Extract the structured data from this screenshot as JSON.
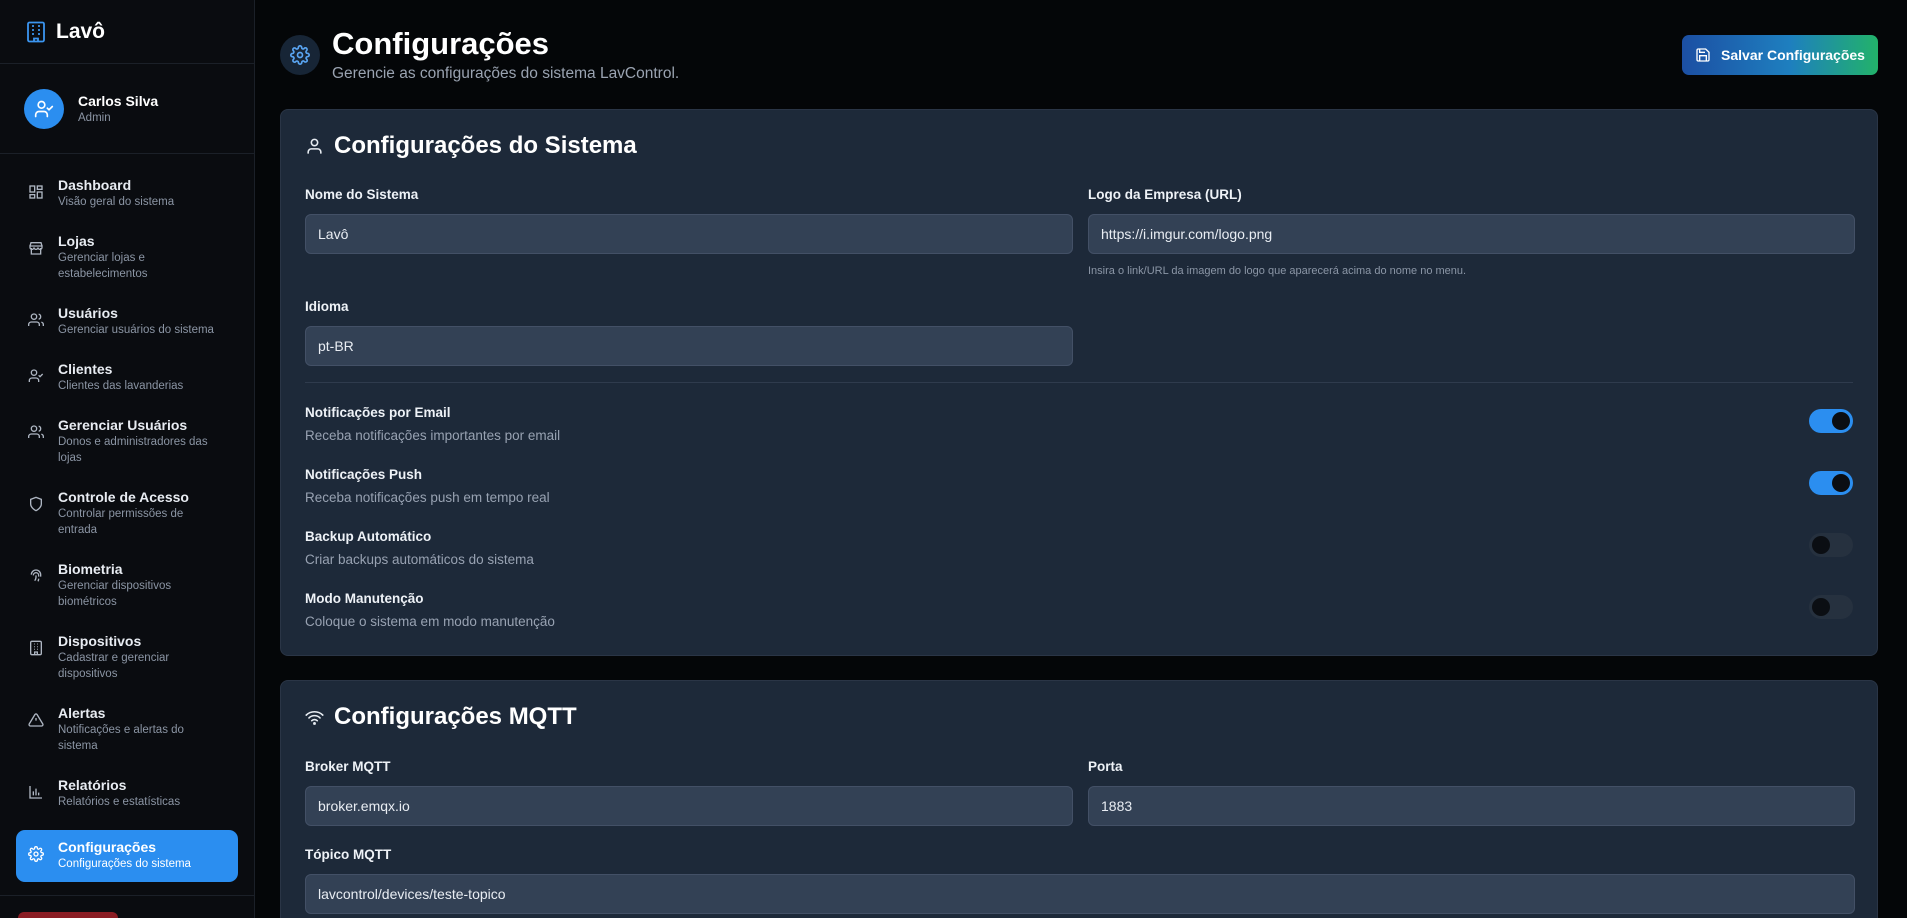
{
  "brand": {
    "name": "Lavô"
  },
  "user": {
    "name": "Carlos Silva",
    "role": "Admin"
  },
  "nav": [
    {
      "label": "Dashboard",
      "sub": "Visão geral do sistema",
      "icon": "grid-icon"
    },
    {
      "label": "Lojas",
      "sub": "Gerenciar lojas e estabelecimentos",
      "icon": "store-icon"
    },
    {
      "label": "Usuários",
      "sub": "Gerenciar usuários do sistema",
      "icon": "users-icon"
    },
    {
      "label": "Clientes",
      "sub": "Clientes das lavanderias",
      "icon": "user-check-icon"
    },
    {
      "label": "Gerenciar Usuários",
      "sub": "Donos e administradores das lojas",
      "icon": "users-icon"
    },
    {
      "label": "Controle de Acesso",
      "sub": "Controlar permissões de entrada",
      "icon": "shield-icon"
    },
    {
      "label": "Biometria",
      "sub": "Gerenciar dispositivos biométricos",
      "icon": "fingerprint-icon"
    },
    {
      "label": "Dispositivos",
      "sub": "Cadastrar e gerenciar dispositivos",
      "icon": "building-icon"
    },
    {
      "label": "Alertas",
      "sub": "Notificações e alertas do sistema",
      "icon": "alert-triangle-icon"
    },
    {
      "label": "Relatórios",
      "sub": "Relatórios e estatísticas",
      "icon": "bar-chart-icon"
    },
    {
      "label": "Configurações",
      "sub": "Configurações do sistema",
      "icon": "gear-icon",
      "active": true
    }
  ],
  "header": {
    "title": "Configurações",
    "subtitle": "Gerencie as configurações do sistema LavControl.",
    "save_label": "Salvar Configurações"
  },
  "system": {
    "title": "Configurações do Sistema",
    "name_label": "Nome do Sistema",
    "name_value": "Lavô",
    "logo_label": "Logo da Empresa (URL)",
    "logo_value": "https://i.imgur.com/logo.png",
    "logo_hint": "Insira o link/URL da imagem do logo que aparecerá acima do nome no menu.",
    "lang_label": "Idioma",
    "lang_value": "pt-BR",
    "toggles": [
      {
        "label": "Notificações por Email",
        "sub": "Receba notificações importantes por email",
        "on": true
      },
      {
        "label": "Notificações Push",
        "sub": "Receba notificações push em tempo real",
        "on": true
      },
      {
        "label": "Backup Automático",
        "sub": "Criar backups automáticos do sistema",
        "on": false
      },
      {
        "label": "Modo Manutenção",
        "sub": "Coloque o sistema em modo manutenção",
        "on": false
      }
    ]
  },
  "mqtt": {
    "title": "Configurações MQTT",
    "broker_label": "Broker MQTT",
    "broker_value": "broker.emqx.io",
    "port_label": "Porta",
    "port_value": "1883",
    "topic_label": "Tópico MQTT",
    "topic_value": "lavcontrol/devices/teste-topico"
  },
  "colors": {
    "accent": "#2b8ef0",
    "card": "#1d2939",
    "background": "#040608"
  }
}
